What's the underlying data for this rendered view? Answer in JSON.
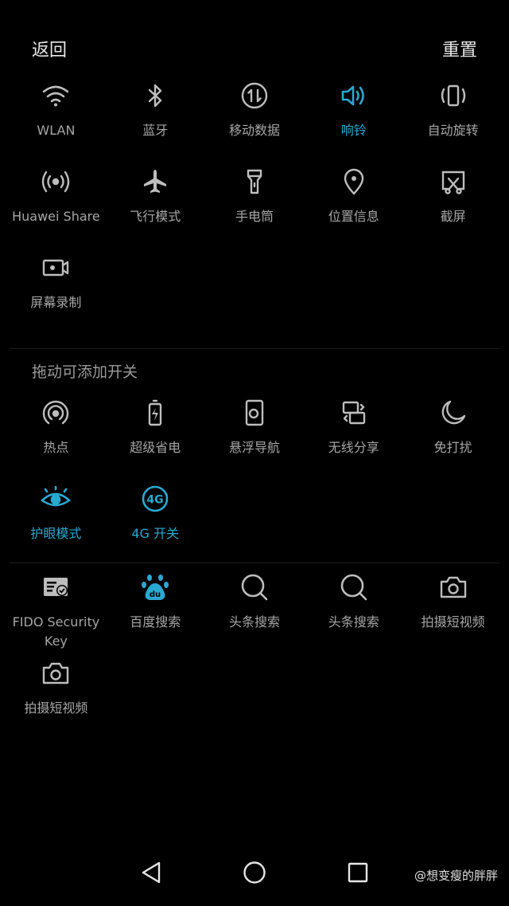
{
  "header": {
    "back_label": "返回",
    "reset_label": "重置"
  },
  "active_tiles": {
    "row1": [
      {
        "label": "WLAN",
        "icon": "wifi-icon",
        "active": false
      },
      {
        "label": "蓝牙",
        "icon": "bluetooth-icon",
        "active": false
      },
      {
        "label": "移动数据",
        "icon": "mobile-data-icon",
        "active": false
      },
      {
        "label": "响铃",
        "icon": "volume-icon",
        "active": true
      },
      {
        "label": "自动旋转",
        "icon": "auto-rotate-icon",
        "active": false
      }
    ],
    "row2": [
      {
        "label": "Huawei Share",
        "icon": "huawei-share-icon",
        "active": false
      },
      {
        "label": "飞行模式",
        "icon": "airplane-icon",
        "active": false
      },
      {
        "label": "手电筒",
        "icon": "flashlight-icon",
        "active": false
      },
      {
        "label": "位置信息",
        "icon": "location-icon",
        "active": false
      },
      {
        "label": "截屏",
        "icon": "screenshot-icon",
        "active": false
      }
    ],
    "row3": [
      {
        "label": "屏幕录制",
        "icon": "screen-record-icon",
        "active": false
      }
    ]
  },
  "available_section": {
    "title": "拖动可添加开关",
    "row1": [
      {
        "label": "热点",
        "icon": "hotspot-icon",
        "active": false
      },
      {
        "label": "超级省电",
        "icon": "battery-saver-icon",
        "active": false
      },
      {
        "label": "悬浮导航",
        "icon": "floating-nav-icon",
        "active": false
      },
      {
        "label": "无线分享",
        "icon": "wireless-share-icon",
        "active": false
      },
      {
        "label": "免打扰",
        "icon": "moon-icon",
        "active": false
      }
    ],
    "row2": [
      {
        "label": "护眼模式",
        "icon": "eye-icon",
        "active": true
      },
      {
        "label": "4G 开关",
        "icon": "4g-icon",
        "active": true
      }
    ]
  },
  "third_party": {
    "row1": [
      {
        "label": "FIDO Security",
        "label2": "Key",
        "icon": "security-key-icon"
      },
      {
        "label": "百度搜索",
        "icon": "baidu-icon"
      },
      {
        "label": "头条搜索",
        "icon": "search-icon"
      },
      {
        "label": "头条搜索",
        "icon": "search-icon"
      },
      {
        "label": "拍摄短视频",
        "icon": "camera-icon"
      }
    ],
    "row2": [
      {
        "label": "拍摄短视频",
        "icon": "camera-icon"
      }
    ]
  },
  "colors": {
    "accent": "#29a9d1",
    "icon": "#bdbdbd",
    "background": "#000000"
  },
  "watermark": "@想变瘦的胖胖"
}
